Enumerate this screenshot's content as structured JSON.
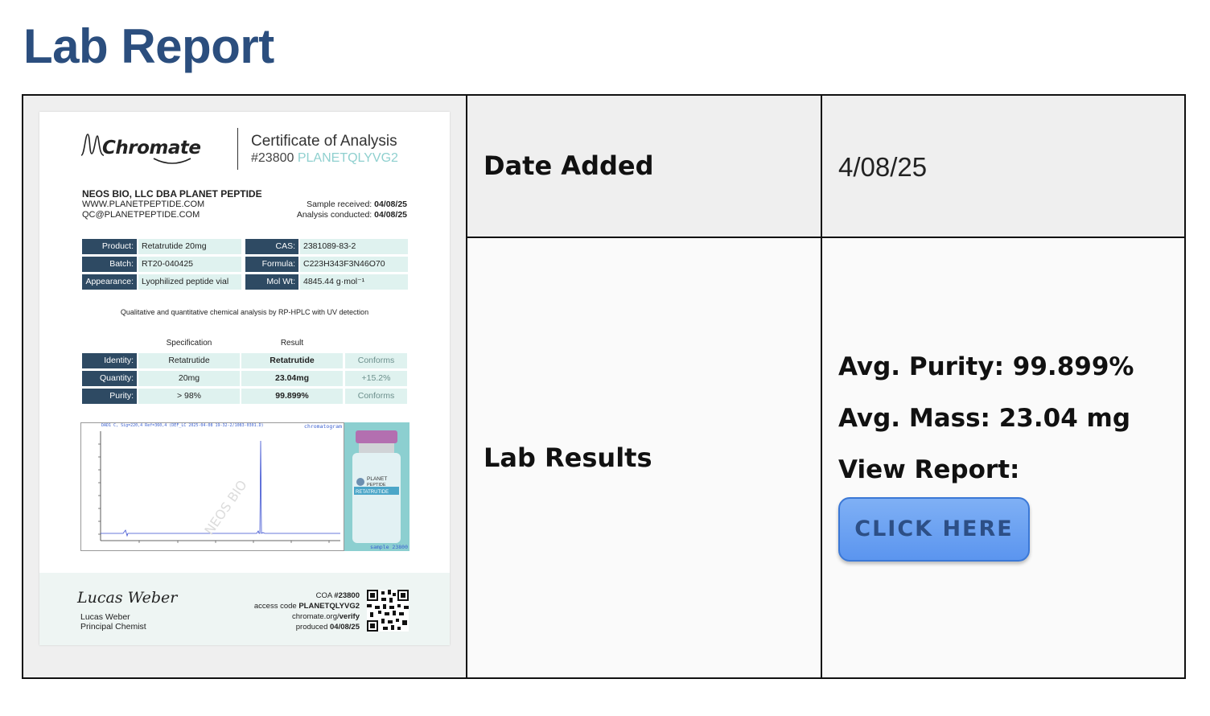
{
  "page_title": "Lab Report",
  "table": {
    "date_label": "Date Added",
    "date_value": "4/08/25",
    "results_label": "Lab Results",
    "avg_purity": "Avg. Purity: 99.899%",
    "avg_mass": "Avg. Mass: 23.04 mg",
    "view_report": "View Report:",
    "button_label": "CLICK HERE"
  },
  "coa": {
    "logo": "Chromate",
    "title": "Certificate of Analysis",
    "number": "#23800",
    "code": "PLANETQLYVG2",
    "company_name": "NEOS BIO, LLC DBA PLANET PEPTIDE",
    "company_web": "WWW.PLANETPEPTIDE.COM",
    "company_email": "QC@PLANETPEPTIDE.COM",
    "received_label": "Sample received:",
    "received_date": "04/08/25",
    "conducted_label": "Analysis conducted:",
    "conducted_date": "04/08/25",
    "info": {
      "product_key": "Product:",
      "product_val": "Retatrutide 20mg",
      "batch_key": "Batch:",
      "batch_val": "RT20-040425",
      "appearance_key": "Appearance:",
      "appearance_val": "Lyophilized peptide vial",
      "cas_key": "CAS:",
      "cas_val": "2381089-83-2",
      "formula_key": "Formula:",
      "formula_val": "C223H343F3N46O70",
      "molwt_key": "Mol Wt:",
      "molwt_val": "4845.44 g·mol⁻¹"
    },
    "method": "Qualitative and quantitative chemical analysis by RP-HPLC with UV detection",
    "spec_header": "Specification",
    "result_header": "Result",
    "spec_rows": [
      {
        "key": "Identity:",
        "spec": "Retatrutide",
        "result": "Retatrutide",
        "status": "Conforms"
      },
      {
        "key": "Quantity:",
        "spec": "20mg",
        "result": "23.04mg",
        "status": "+15.2%"
      },
      {
        "key": "Purity:",
        "spec": "> 98%",
        "result": "99.899%",
        "status": "Conforms"
      }
    ],
    "chrom_label": "chromatogram",
    "chrom_header": "DAD1 C, Sig=220,4 Ref=360,4 (DEF_LC 2025-04-08 19-32-2/1083-0301.D)",
    "sample_label": "sample 23800",
    "signature": "Lucas Weber",
    "signer_name": "Lucas Weber",
    "signer_role": "Principal Chemist",
    "coa_label": "COA",
    "coa_number": "#23800",
    "access_label": "access code",
    "access_code": "PLANETQLYVG2",
    "verify_domain": "chromate.org/",
    "verify_path": "verify",
    "produced_label": "produced",
    "produced_date": "04/08/25"
  },
  "colors": {
    "title": "#2b4e7e",
    "button": "#6aa3f2",
    "header_band": "#2e4a63",
    "teal_cell": "#dff2ef"
  }
}
